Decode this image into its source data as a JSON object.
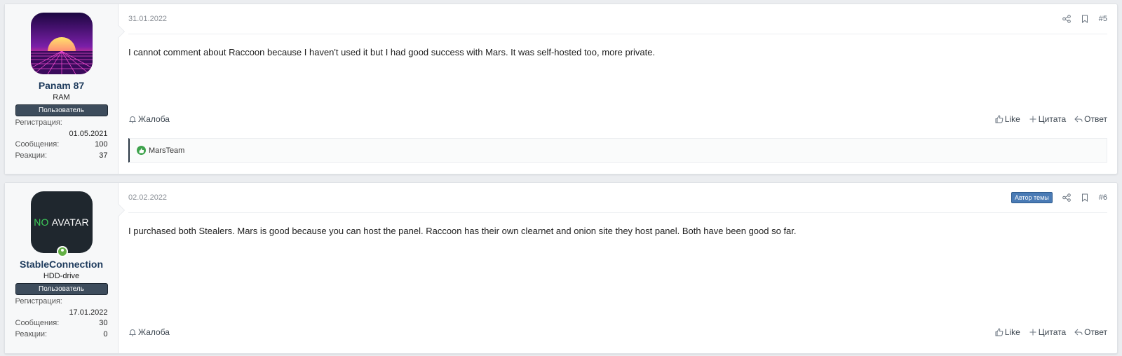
{
  "posts": [
    {
      "date": "31.01.2022",
      "number": "#5",
      "author_badge": "",
      "user": {
        "name": "Panam 87",
        "title": "RAM",
        "role": "Пользователь",
        "reg_label": "Регистрация:",
        "reg_date": "01.05.2021",
        "msgs_label": "Сообщения:",
        "msgs": "100",
        "reacts_label": "Реакции:",
        "reacts": "37",
        "avatar": "synthwave-sunset-avatar"
      },
      "body": "I cannot comment about Raccoon because I haven't used it but I had good success with Mars. It was self-hosted too, more private.",
      "report": "Жалоба",
      "like": "Like",
      "quote": "Цитата",
      "reply": "Ответ",
      "reactions_by": "MarsTeam"
    },
    {
      "date": "02.02.2022",
      "number": "#6",
      "author_badge": "Автор темы",
      "user": {
        "name": "StableConnection",
        "title": "HDD-drive",
        "role": "Пользователь",
        "reg_label": "Регистрация:",
        "reg_date": "17.01.2022",
        "msgs_label": "Сообщения:",
        "msgs": "30",
        "reacts_label": "Реакции:",
        "reacts": "0",
        "avatar_no": "NO",
        "avatar_text": "AVATAR"
      },
      "body": "I purchased both Stealers. Mars is good because you can host the panel. Raccoon has their own clearnet and onion site they host panel. Both have been good so far.",
      "report": "Жалоба",
      "like": "Like",
      "quote": "Цитата",
      "reply": "Ответ"
    }
  ],
  "colors": {
    "role_badge": "#3d4c5c",
    "author_badge": "#4a7bb5",
    "online": "#63b044",
    "like_green": "#3fa34d"
  }
}
